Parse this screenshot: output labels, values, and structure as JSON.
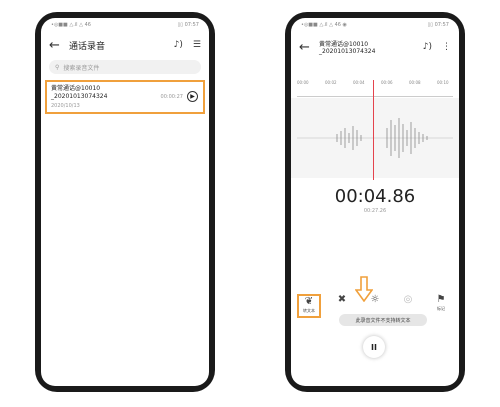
{
  "left": {
    "status_left": "•◎■■ △.il △ 46",
    "status_right": "▯▯ 07:57",
    "title": "通话录音",
    "search_placeholder": "搜索录音文件",
    "recording": {
      "name_line1": "黄常通话@10010",
      "name_line2": "_20201013074324",
      "date": "2020/10/13",
      "duration": "00:00:27"
    },
    "accent": "#f0a03c"
  },
  "right": {
    "status_left": "•◎■■ △.il △ 46 ◉",
    "status_right": "▯▯ 07:57",
    "title_line1": "黄常通话@10010",
    "title_line2": "_20201013074324",
    "ruler_ticks": [
      "00:00",
      "00:02",
      "00:04",
      "00:06",
      "00:08",
      "00:10"
    ],
    "time_big": "00:04.86",
    "time_total": "00:27.26",
    "tools": [
      {
        "icon": "❦",
        "label": "转文本",
        "icon_name": "transcribe-icon"
      },
      {
        "icon": "✖",
        "label": "",
        "icon_name": "scissors-icon"
      },
      {
        "icon": "☼",
        "label": "",
        "icon_name": "speed-icon"
      },
      {
        "icon": "◎",
        "label": "",
        "icon_name": "settings-icon"
      },
      {
        "icon": "⚑",
        "label": "标记",
        "icon_name": "bookmark-icon"
      }
    ],
    "tooltip": "此录音文件不支持转文本",
    "pause_label": "II",
    "playhead_color": "#e4434d"
  }
}
